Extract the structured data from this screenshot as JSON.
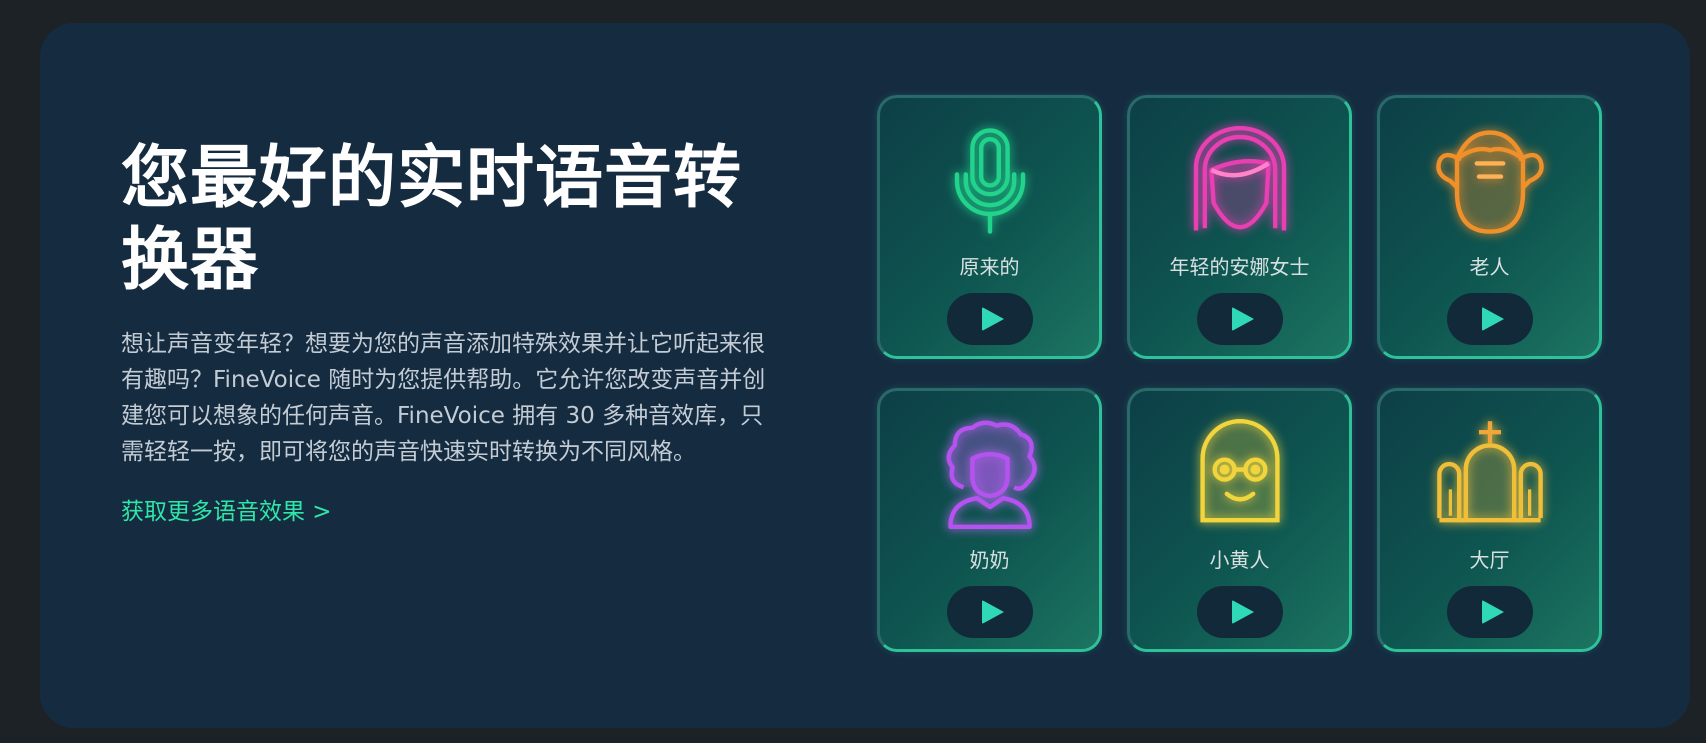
{
  "hero": {
    "title": "您最好的实时语音转换器",
    "description": "想让声音变年轻？想要为您的声音添加特殊效果并让它听起来很有趣吗？FineVoice 随时为您提供帮助。它允许您改变声音并创建您可以想象的任何声音。FineVoice 拥有 30 多种音效库，只需轻轻一按，即可将您的声音快速实时转换为不同风格。",
    "link_label": "获取更多语音效果 >"
  },
  "voices": [
    {
      "label": "原来的",
      "icon": "microphone-icon",
      "color": "#22d38c"
    },
    {
      "label": "年轻的安娜女士",
      "icon": "young-lady-icon",
      "color": "#e83fb3"
    },
    {
      "label": "老人",
      "icon": "old-man-icon",
      "color": "#f0902a"
    },
    {
      "label": "奶奶",
      "icon": "grandma-icon",
      "color": "#b552f0"
    },
    {
      "label": "小黄人",
      "icon": "minion-icon",
      "color": "#f2d53c"
    },
    {
      "label": "大厅",
      "icon": "hall-icon",
      "color": "#efbf3a"
    }
  ],
  "colors": {
    "page_bg": "#1d2226",
    "panel_bg": "#152b40",
    "accent": "#2fe6a8",
    "play_icon": "#2fd9b8"
  }
}
